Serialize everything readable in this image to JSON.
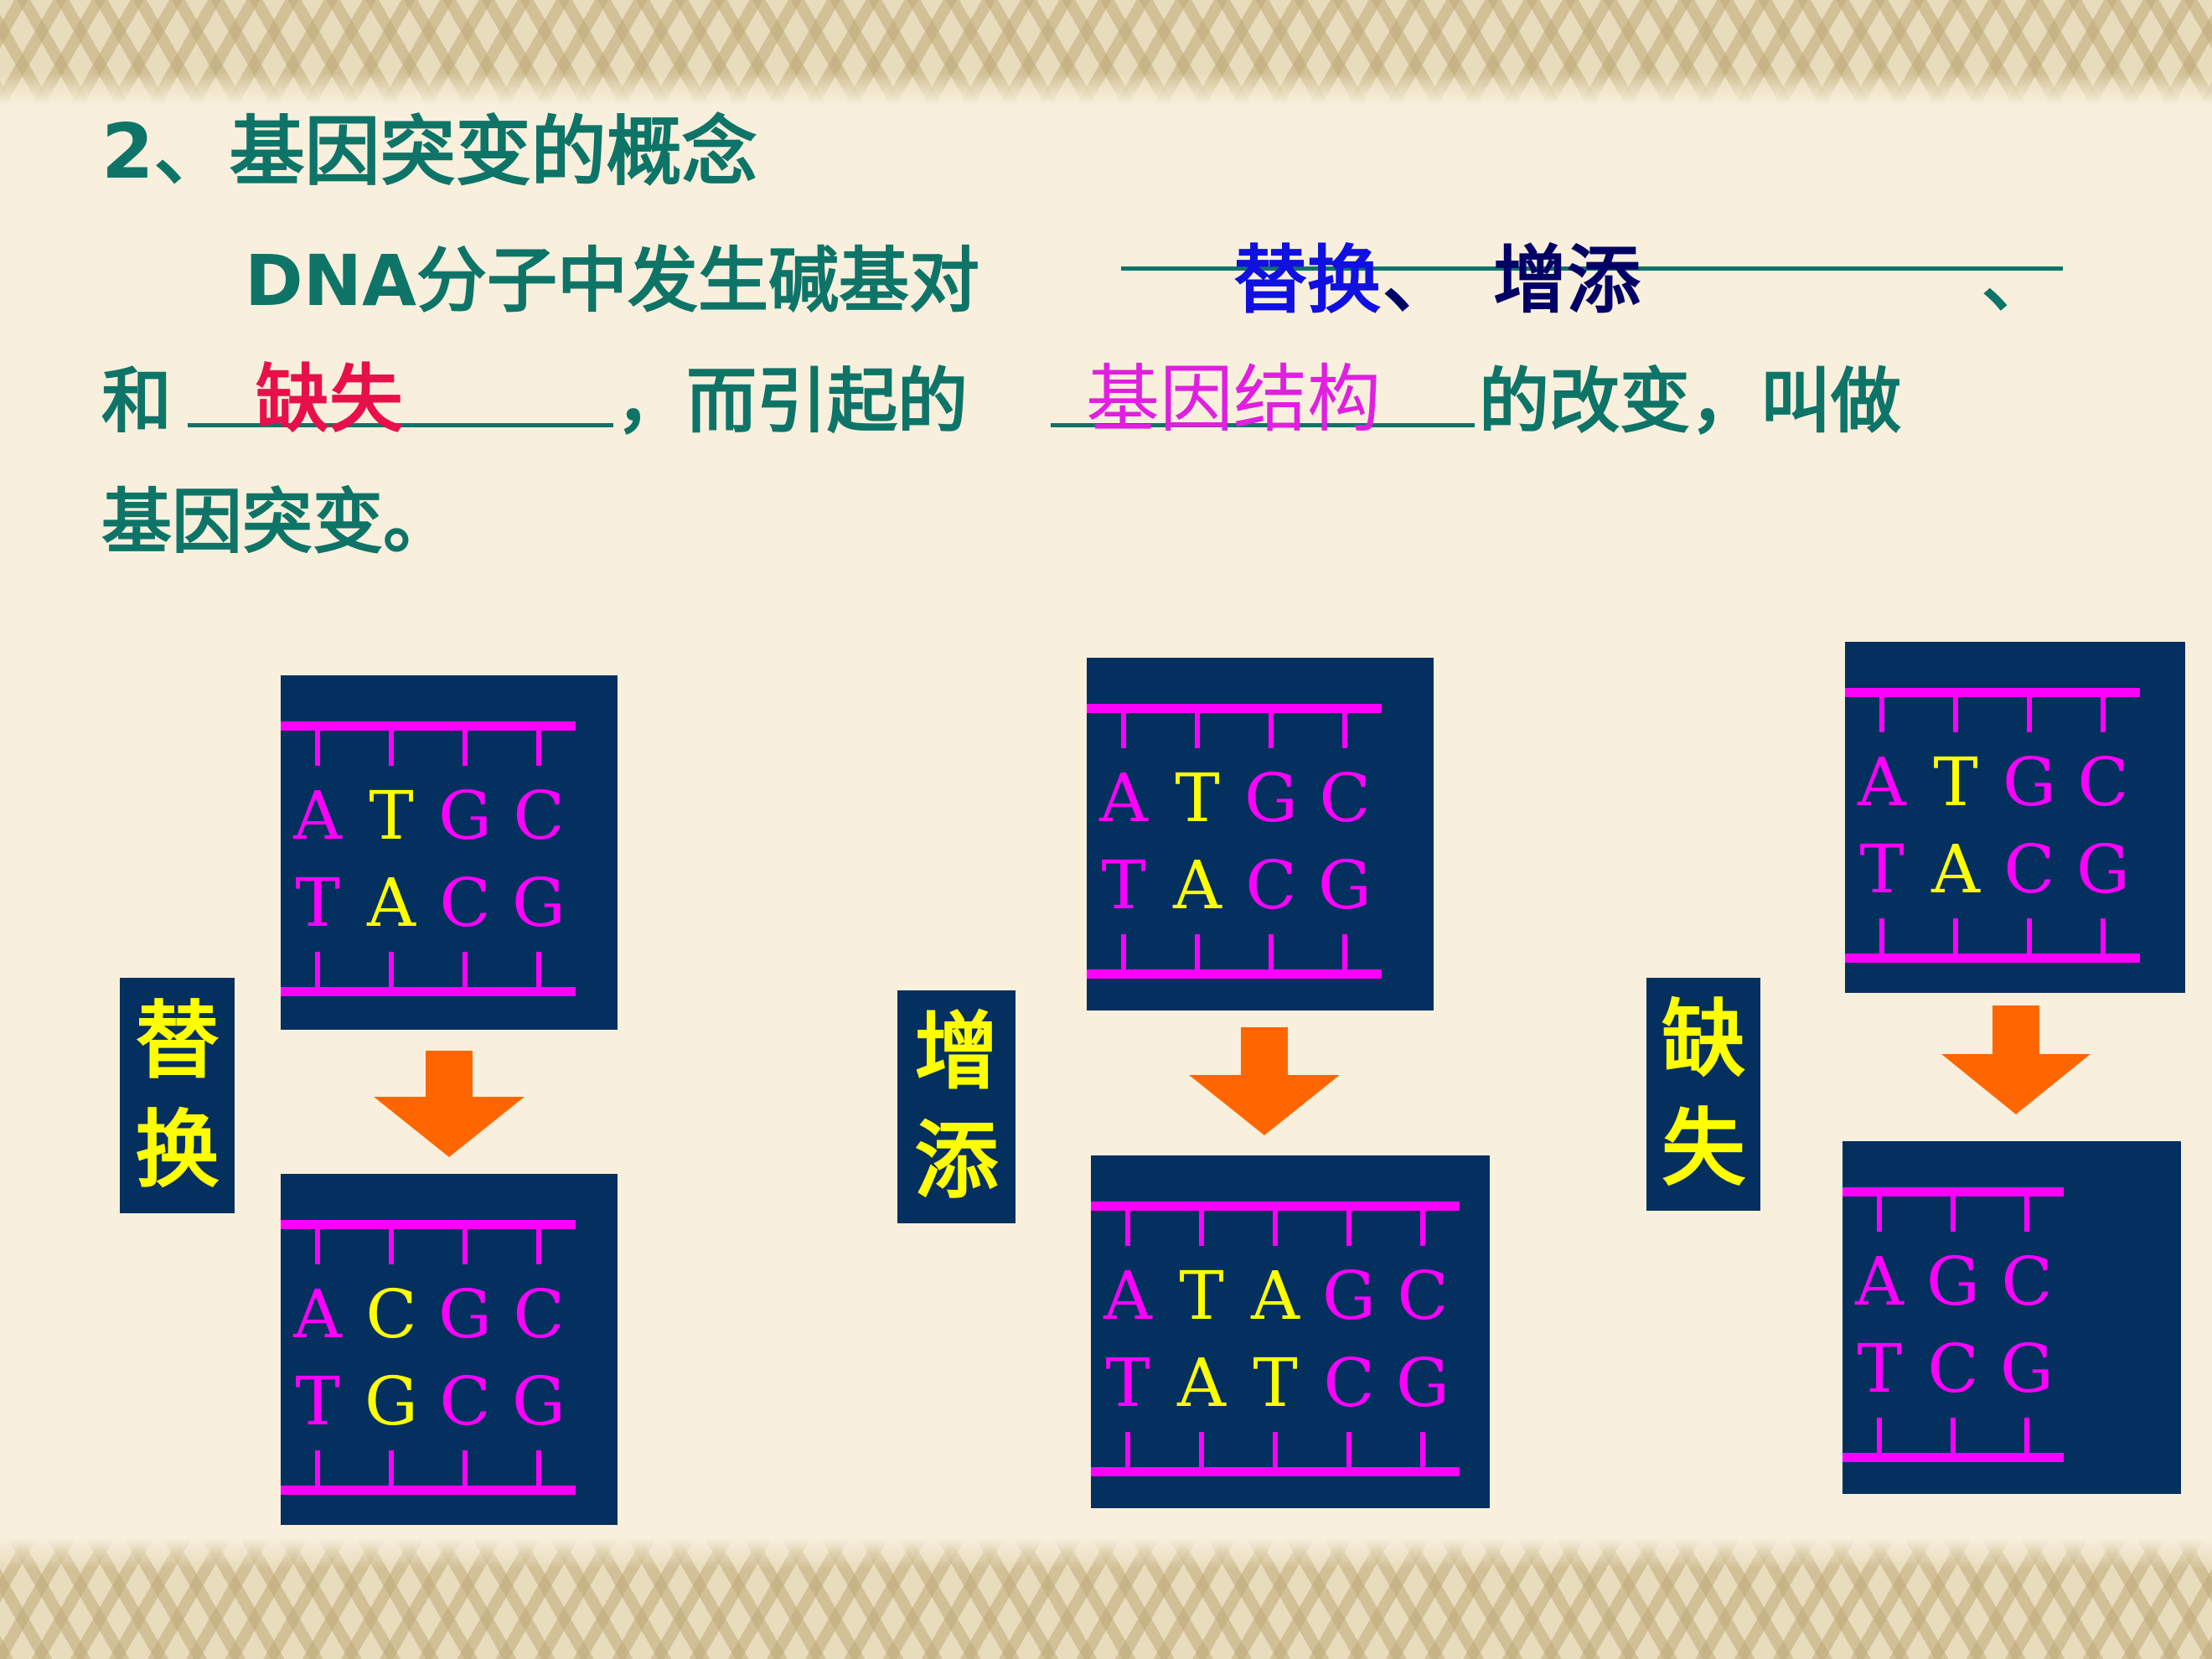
{
  "title": "2、基因突变的概念",
  "definition": {
    "line1_prefix": "DNA分子中发生碱基对",
    "blank1_answer_a": "替换",
    "blank1_sep": "、",
    "blank1_answer_b": "增添",
    "line1_suffix": "、",
    "line2_prefix": "和",
    "blank2_answer": "缺失",
    "line2_middle": "，而引起的",
    "blank3_answer": "基因结构",
    "line2_suffix": "的改变，叫做",
    "line3": "基因突变。"
  },
  "colors": {
    "text": "#0e7468",
    "answer_substitution": "#1010e0",
    "answer_addition": "#000066",
    "answer_deletion": "#e8104a",
    "answer_structure": "#e020e0",
    "box": "#04305f",
    "strand": "#ff00ff",
    "highlight": "#ffff00",
    "arrow": "#ff6600"
  },
  "examples": [
    {
      "label_chars": [
        "替",
        "换"
      ],
      "before": {
        "top": "ATGC",
        "bottom": "TACG",
        "highlight": [
          1
        ]
      },
      "after": {
        "top": "ACGC",
        "bottom": "TGCG",
        "highlight": [
          1
        ]
      }
    },
    {
      "label_chars": [
        "增",
        "添"
      ],
      "before": {
        "top": "ATGC",
        "bottom": "TACG",
        "highlight": [
          1
        ]
      },
      "after": {
        "top": "ATAGC",
        "bottom": "TATCG",
        "highlight": [
          1,
          2
        ]
      }
    },
    {
      "label_chars": [
        "缺",
        "失"
      ],
      "before": {
        "top": "ATGC",
        "bottom": "TACG",
        "highlight": [
          1
        ]
      },
      "after": {
        "top": "AGC",
        "bottom": "TCG",
        "highlight": []
      }
    }
  ]
}
